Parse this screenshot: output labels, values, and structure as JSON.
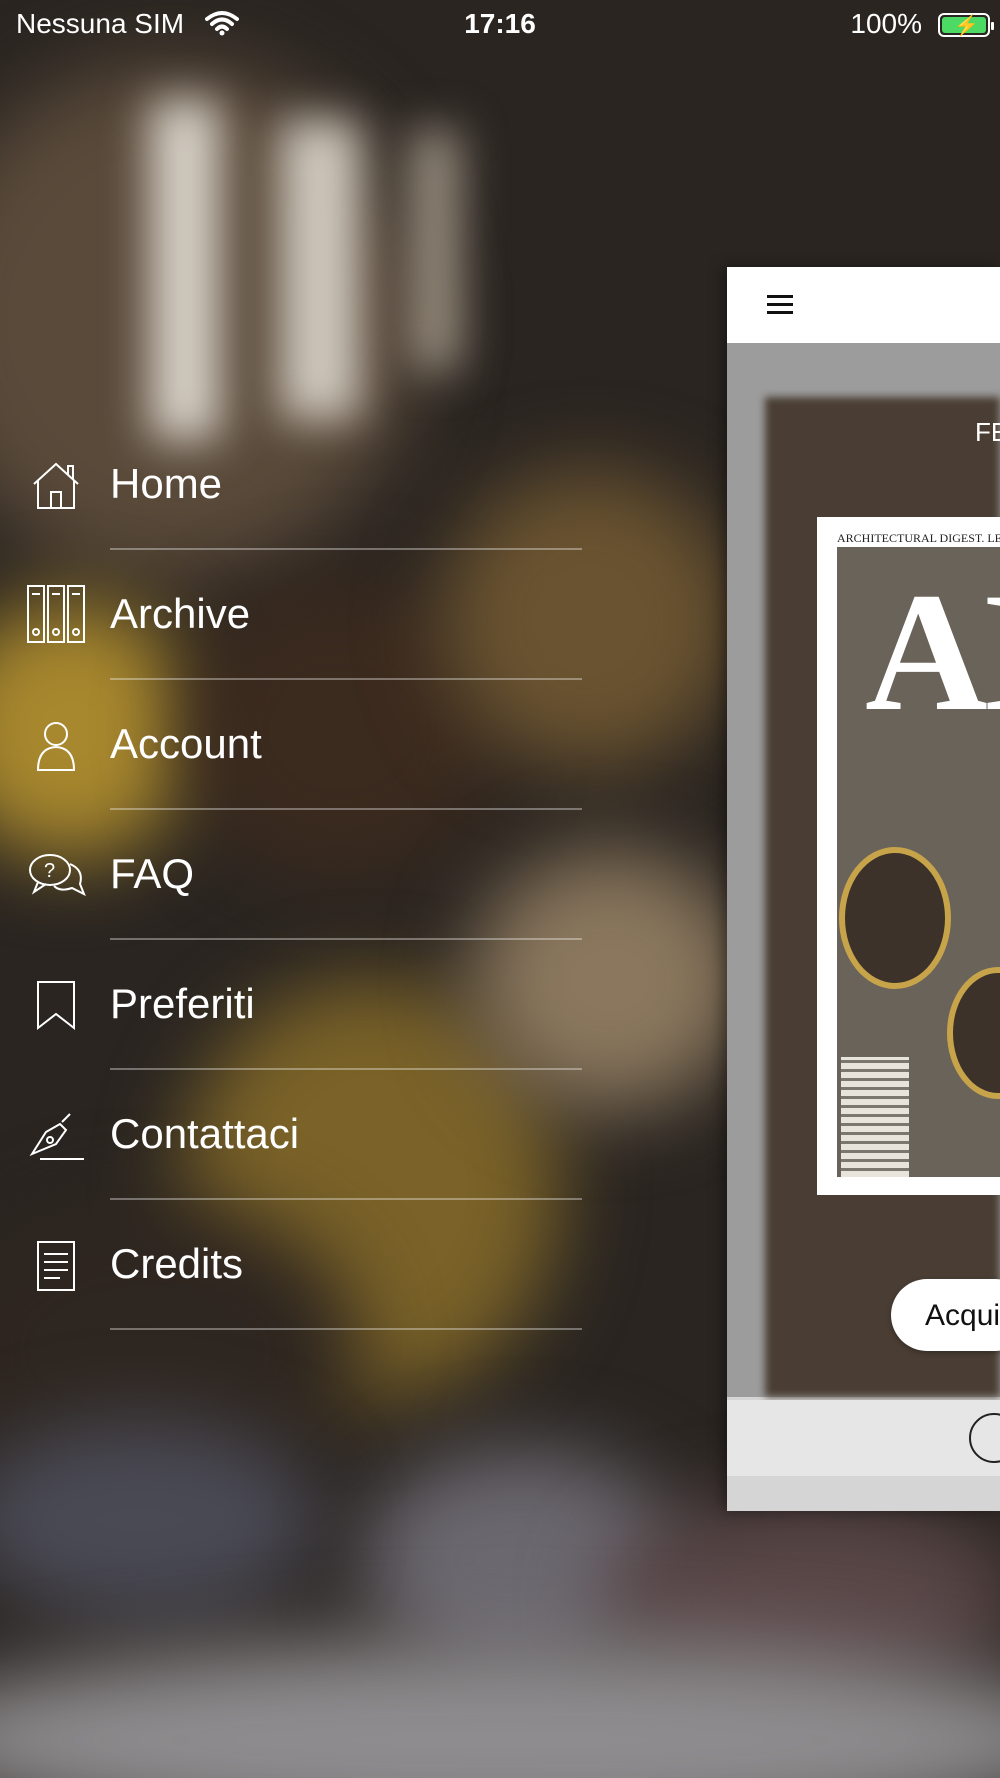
{
  "status_bar": {
    "carrier": "Nessuna SIM",
    "time": "17:16",
    "battery": "100%",
    "wifi_icon": "wifi-icon",
    "battery_icon": "battery-charging-icon"
  },
  "menu": {
    "items": [
      {
        "label": "Home",
        "icon": "home-icon"
      },
      {
        "label": "Archive",
        "icon": "archive-binders-icon"
      },
      {
        "label": "Account",
        "icon": "person-icon"
      },
      {
        "label": "FAQ",
        "icon": "faq-bubbles-icon"
      },
      {
        "label": "Preferiti",
        "icon": "bookmark-icon"
      },
      {
        "label": "Contattaci",
        "icon": "pen-signature-icon"
      },
      {
        "label": "Credits",
        "icon": "document-icon"
      }
    ]
  },
  "panel": {
    "menu_icon": "hamburger-icon",
    "issue_label": "FE",
    "cover_tagline": "ARCHITECTURAL DIGEST. LE",
    "cover_masthead": "AI",
    "buy_button": "Acqui"
  }
}
